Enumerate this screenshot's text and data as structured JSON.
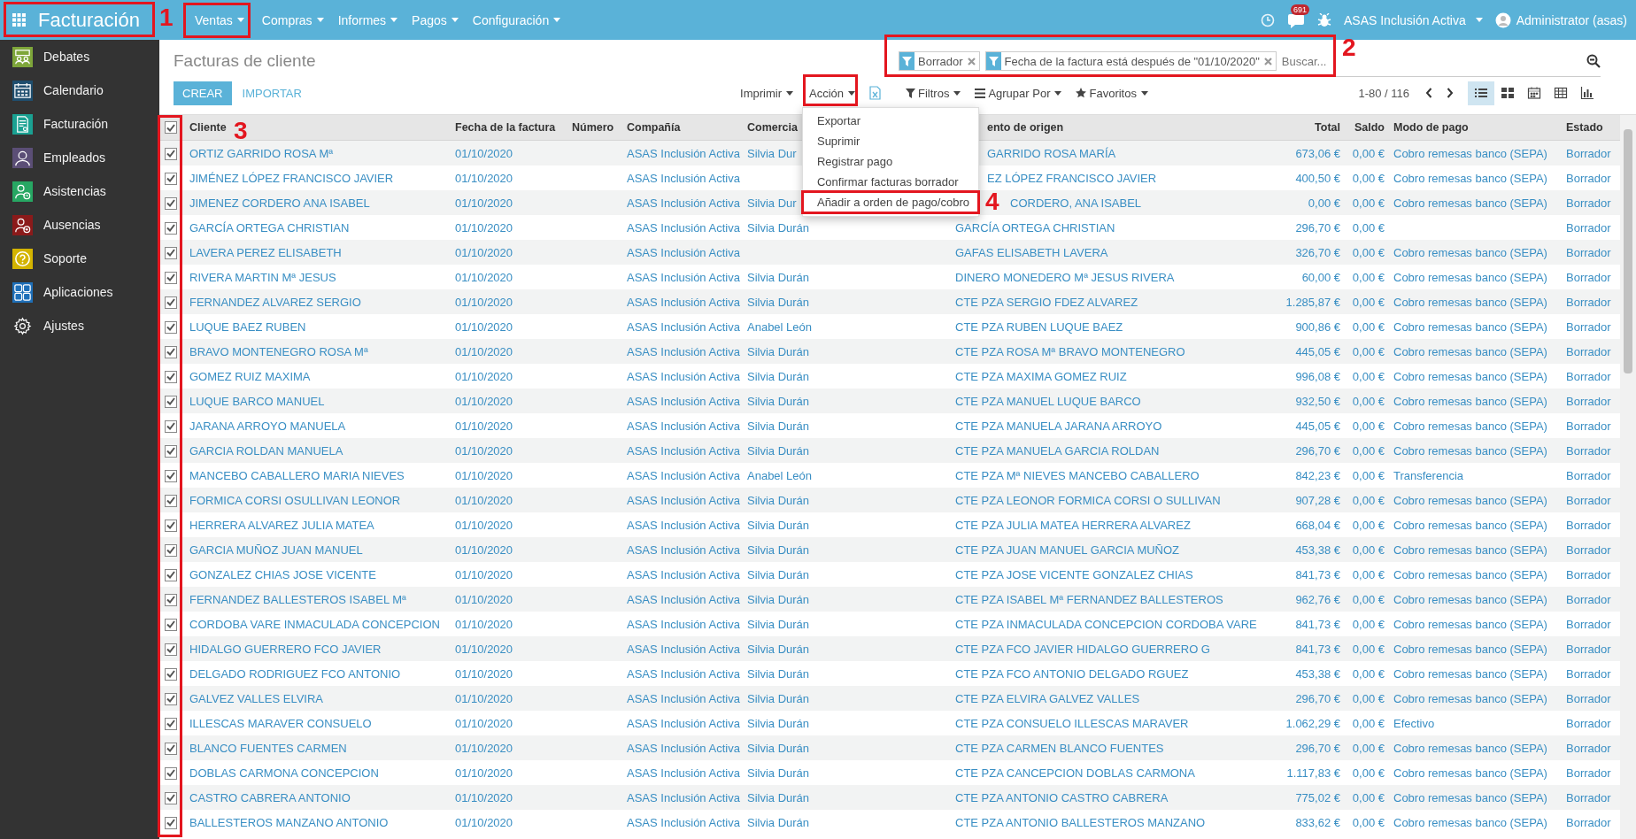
{
  "topbar": {
    "app_title": "Facturación",
    "menus": [
      {
        "label": "Ventas"
      },
      {
        "label": "Compras"
      },
      {
        "label": "Informes"
      },
      {
        "label": "Pagos"
      },
      {
        "label": "Configuración"
      }
    ],
    "messages_count": "691",
    "company": "ASAS Inclusión Activa",
    "user": "Administrator (asas)"
  },
  "sidebar": {
    "items": [
      {
        "label": "Debates",
        "kind": "debates",
        "color": "#7ea63a"
      },
      {
        "label": "Calendario",
        "kind": "calendar",
        "color": "#1f4e6e"
      },
      {
        "label": "Facturación",
        "kind": "invoice",
        "color": "#1aa192"
      },
      {
        "label": "Empleados",
        "kind": "employee",
        "color": "#5b4e76"
      },
      {
        "label": "Asistencias",
        "kind": "attendance",
        "color": "#27a763"
      },
      {
        "label": "Ausencias",
        "kind": "leave",
        "color": "#8b1a1a"
      },
      {
        "label": "Soporte",
        "kind": "support",
        "color": "#d4b400"
      },
      {
        "label": "Aplicaciones",
        "kind": "apps",
        "color": "#1e6fb8"
      },
      {
        "label": "Ajustes",
        "kind": "settings"
      }
    ]
  },
  "control_panel": {
    "title": "Facturas de cliente",
    "create_button": "CREAR",
    "import_button": "IMPORTAR",
    "print_menu": "Imprimir",
    "action_menu": "Acción",
    "action_items": [
      "Exportar",
      "Suprimir",
      "Registrar pago",
      "Confirmar facturas borrador",
      "Añadir a orden de pago/cobro"
    ],
    "search": {
      "facets": [
        "Borrador",
        "Fecha de la factura está después de \"01/10/2020\""
      ],
      "placeholder": "Buscar..."
    },
    "filters": "Filtros",
    "group_by": "Agrupar Por",
    "favorites": "Favoritos",
    "pager": "1-80 / 116",
    "views": [
      {
        "kind": "list",
        "selected": true
      },
      {
        "kind": "kanban",
        "selected": false
      },
      {
        "kind": "calendar",
        "selected": false
      },
      {
        "kind": "pivot",
        "selected": false
      },
      {
        "kind": "graph",
        "selected": false
      }
    ]
  },
  "table": {
    "select_all": {
      "checked": true
    },
    "columns": [
      {
        "label": "Cliente",
        "kind": "text"
      },
      {
        "label": "Fecha de la factura",
        "kind": "text"
      },
      {
        "label": "Número",
        "kind": "text"
      },
      {
        "label": "Compañía",
        "kind": "text"
      },
      {
        "label": "Comercia",
        "kind": "text"
      },
      {
        "label": "ento de origen",
        "kind": "text"
      },
      {
        "label": "Total",
        "kind": "money"
      },
      {
        "label": "Saldo",
        "kind": "money"
      },
      {
        "label": "Modo de pago",
        "kind": "text"
      },
      {
        "label": "Estado",
        "kind": "text"
      }
    ],
    "rows": [
      {
        "checked": true,
        "cells": [
          "ORTIZ GARRIDO ROSA Mª",
          "01/10/2020",
          null,
          "ASAS Inclusión Activa",
          "Silvia Dur",
          "GARRIDO ROSA MARÍA",
          "673,06 €",
          "0,00 €",
          "Cobro remesas banco (SEPA)",
          "Borrador"
        ]
      },
      {
        "checked": true,
        "cells": [
          "JIMÉNEZ LÓPEZ FRANCISCO JAVIER",
          "01/10/2020",
          null,
          "ASAS Inclusión Activa",
          null,
          "EZ LÓPEZ FRANCISCO JAVIER",
          "400,50 €",
          "0,00 €",
          "Cobro remesas banco (SEPA)",
          "Borrador"
        ]
      },
      {
        "checked": true,
        "cells": [
          "JIMENEZ CORDERO ANA ISABEL",
          "01/10/2020",
          null,
          "ASAS Inclusión Activa",
          "Silvia Dur",
          "CORDERO, ANA ISABEL",
          "0,00 €",
          "0,00 €",
          "Cobro remesas banco (SEPA)",
          "Borrador"
        ]
      },
      {
        "checked": true,
        "cells": [
          "GARCÍA ORTEGA CHRISTIAN",
          "01/10/2020",
          null,
          "ASAS Inclusión Activa",
          "Silvia Durán",
          "GARCÍA ORTEGA CHRISTIAN",
          "296,70 €",
          "0,00 €",
          null,
          "Borrador"
        ]
      },
      {
        "checked": true,
        "cells": [
          "LAVERA PEREZ ELISABETH",
          "01/10/2020",
          null,
          "ASAS Inclusión Activa",
          null,
          "GAFAS ELISABETH LAVERA",
          "326,70 €",
          "0,00 €",
          "Cobro remesas banco (SEPA)",
          "Borrador"
        ]
      },
      {
        "checked": true,
        "cells": [
          "RIVERA MARTIN Mª JESUS",
          "01/10/2020",
          null,
          "ASAS Inclusión Activa",
          "Silvia Durán",
          "DINERO MONEDERO Mª JESUS RIVERA",
          "60,00 €",
          "0,00 €",
          "Cobro remesas banco (SEPA)",
          "Borrador"
        ]
      },
      {
        "checked": true,
        "cells": [
          "FERNANDEZ ALVAREZ SERGIO",
          "01/10/2020",
          null,
          "ASAS Inclusión Activa",
          "Silvia Durán",
          "CTE PZA SERGIO FDEZ ALVAREZ",
          "1.285,87 €",
          "0,00 €",
          "Cobro remesas banco (SEPA)",
          "Borrador"
        ]
      },
      {
        "checked": true,
        "cells": [
          "LUQUE BAEZ RUBEN",
          "01/10/2020",
          null,
          "ASAS Inclusión Activa",
          "Anabel León",
          "CTE PZA RUBEN LUQUE BAEZ",
          "900,86 €",
          "0,00 €",
          "Cobro remesas banco (SEPA)",
          "Borrador"
        ]
      },
      {
        "checked": true,
        "cells": [
          "BRAVO MONTENEGRO ROSA Mª",
          "01/10/2020",
          null,
          "ASAS Inclusión Activa",
          "Silvia Durán",
          "CTE PZA ROSA Mª BRAVO MONTENEGRO",
          "445,05 €",
          "0,00 €",
          "Cobro remesas banco (SEPA)",
          "Borrador"
        ]
      },
      {
        "checked": true,
        "cells": [
          "GOMEZ RUIZ MAXIMA",
          "01/10/2020",
          null,
          "ASAS Inclusión Activa",
          "Silvia Durán",
          "CTE PZA MAXIMA GOMEZ RUIZ",
          "996,08 €",
          "0,00 €",
          "Cobro remesas banco (SEPA)",
          "Borrador"
        ]
      },
      {
        "checked": true,
        "cells": [
          "LUQUE BARCO MANUEL",
          "01/10/2020",
          null,
          "ASAS Inclusión Activa",
          "Silvia Durán",
          "CTE PZA MANUEL LUQUE BARCO",
          "932,50 €",
          "0,00 €",
          "Cobro remesas banco (SEPA)",
          "Borrador"
        ]
      },
      {
        "checked": true,
        "cells": [
          "JARANA ARROYO MANUELA",
          "01/10/2020",
          null,
          "ASAS Inclusión Activa",
          "Silvia Durán",
          "CTE PZA MANUELA JARANA ARROYO",
          "445,05 €",
          "0,00 €",
          "Cobro remesas banco (SEPA)",
          "Borrador"
        ]
      },
      {
        "checked": true,
        "cells": [
          "GARCIA ROLDAN MANUELA",
          "01/10/2020",
          null,
          "ASAS Inclusión Activa",
          "Silvia Durán",
          "CTE PZA MANUELA GARCIA ROLDAN",
          "296,70 €",
          "0,00 €",
          "Cobro remesas banco (SEPA)",
          "Borrador"
        ]
      },
      {
        "checked": true,
        "cells": [
          "MANCEBO CABALLERO MARIA NIEVES",
          "01/10/2020",
          null,
          "ASAS Inclusión Activa",
          "Anabel León",
          "CTE PZA Mª NIEVES MANCEBO CABALLERO",
          "842,23 €",
          "0,00 €",
          "Transferencia",
          "Borrador"
        ]
      },
      {
        "checked": true,
        "cells": [
          "FORMICA CORSI OSULLIVAN LEONOR",
          "01/10/2020",
          null,
          "ASAS Inclusión Activa",
          "Silvia Durán",
          "CTE PZA LEONOR FORMICA CORSI O SULLIVAN",
          "907,28 €",
          "0,00 €",
          "Cobro remesas banco (SEPA)",
          "Borrador"
        ]
      },
      {
        "checked": true,
        "cells": [
          "HERRERA ALVAREZ JULIA MATEA",
          "01/10/2020",
          null,
          "ASAS Inclusión Activa",
          "Silvia Durán",
          "CTE PZA JULIA MATEA HERRERA ALVAREZ",
          "668,04 €",
          "0,00 €",
          "Cobro remesas banco (SEPA)",
          "Borrador"
        ]
      },
      {
        "checked": true,
        "cells": [
          "GARCIA MUÑOZ JUAN MANUEL",
          "01/10/2020",
          null,
          "ASAS Inclusión Activa",
          "Silvia Durán",
          "CTE PZA JUAN MANUEL GARCIA MUÑOZ",
          "453,38 €",
          "0,00 €",
          "Cobro remesas banco (SEPA)",
          "Borrador"
        ]
      },
      {
        "checked": true,
        "cells": [
          "GONZALEZ CHIAS JOSE VICENTE",
          "01/10/2020",
          null,
          "ASAS Inclusión Activa",
          "Silvia Durán",
          "CTE PZA JOSE VICENTE GONZALEZ CHIAS",
          "841,73 €",
          "0,00 €",
          "Cobro remesas banco (SEPA)",
          "Borrador"
        ]
      },
      {
        "checked": true,
        "cells": [
          "FERNANDEZ BALLESTEROS ISABEL Mª",
          "01/10/2020",
          null,
          "ASAS Inclusión Activa",
          "Silvia Durán",
          "CTE PZA ISABEL Mª FERNANDEZ BALLESTEROS",
          "962,76 €",
          "0,00 €",
          "Cobro remesas banco (SEPA)",
          "Borrador"
        ]
      },
      {
        "checked": true,
        "cells": [
          "CORDOBA VARE INMACULADA CONCEPCION",
          "01/10/2020",
          null,
          "ASAS Inclusión Activa",
          "Silvia Durán",
          "CTE PZA INMACULADA CONCEPCION CORDOBA VARE",
          "841,73 €",
          "0,00 €",
          "Cobro remesas banco (SEPA)",
          "Borrador"
        ]
      },
      {
        "checked": true,
        "cells": [
          "HIDALGO GUERRERO FCO JAVIER",
          "01/10/2020",
          null,
          "ASAS Inclusión Activa",
          "Silvia Durán",
          "CTE PZA FCO JAVIER HIDALGO GUERRERO G",
          "841,73 €",
          "0,00 €",
          "Cobro remesas banco (SEPA)",
          "Borrador"
        ]
      },
      {
        "checked": true,
        "cells": [
          "DELGADO RODRIGUEZ FCO ANTONIO",
          "01/10/2020",
          null,
          "ASAS Inclusión Activa",
          "Silvia Durán",
          "CTE PZA FCO ANTONIO DELGADO RGUEZ",
          "453,38 €",
          "0,00 €",
          "Cobro remesas banco (SEPA)",
          "Borrador"
        ]
      },
      {
        "checked": true,
        "cells": [
          "GALVEZ VALLES ELVIRA",
          "01/10/2020",
          null,
          "ASAS Inclusión Activa",
          "Silvia Durán",
          "CTE PZA ELVIRA GALVEZ VALLES",
          "296,70 €",
          "0,00 €",
          "Cobro remesas banco (SEPA)",
          "Borrador"
        ]
      },
      {
        "checked": true,
        "cells": [
          "ILLESCAS MARAVER CONSUELO",
          "01/10/2020",
          null,
          "ASAS Inclusión Activa",
          "Silvia Durán",
          "CTE PZA CONSUELO ILLESCAS MARAVER",
          "1.062,29 €",
          "0,00 €",
          "Efectivo",
          "Borrador"
        ]
      },
      {
        "checked": true,
        "cells": [
          "BLANCO FUENTES CARMEN",
          "01/10/2020",
          null,
          "ASAS Inclusión Activa",
          "Silvia Durán",
          "CTE PZA CARMEN BLANCO FUENTES",
          "296,70 €",
          "0,00 €",
          "Cobro remesas banco (SEPA)",
          "Borrador"
        ]
      },
      {
        "checked": true,
        "cells": [
          "DOBLAS CARMONA CONCEPCION",
          "01/10/2020",
          null,
          "ASAS Inclusión Activa",
          "Silvia Durán",
          "CTE PZA CANCEPCION DOBLAS CARMONA",
          "1.117,83 €",
          "0,00 €",
          "Cobro remesas banco (SEPA)",
          "Borrador"
        ]
      },
      {
        "checked": true,
        "cells": [
          "CASTRO CABRERA ANTONIO",
          "01/10/2020",
          null,
          "ASAS Inclusión Activa",
          "Silvia Durán",
          "CTE PZA ANTONIO CASTRO CABRERA",
          "775,02 €",
          "0,00 €",
          "Cobro remesas banco (SEPA)",
          "Borrador"
        ]
      },
      {
        "checked": true,
        "cells": [
          "BALLESTEROS MANZANO ANTONIO",
          "01/10/2020",
          null,
          "ASAS Inclusión Activa",
          "Silvia Durán",
          "CTE PZA ANTONIO BALLESTEROS MANZANO",
          "833,62 €",
          "0,00 €",
          "Cobro remesas banco (SEPA)",
          "Borrador"
        ]
      }
    ]
  },
  "annotations": {
    "numbers": [
      "1",
      "2",
      "3",
      "4"
    ]
  }
}
